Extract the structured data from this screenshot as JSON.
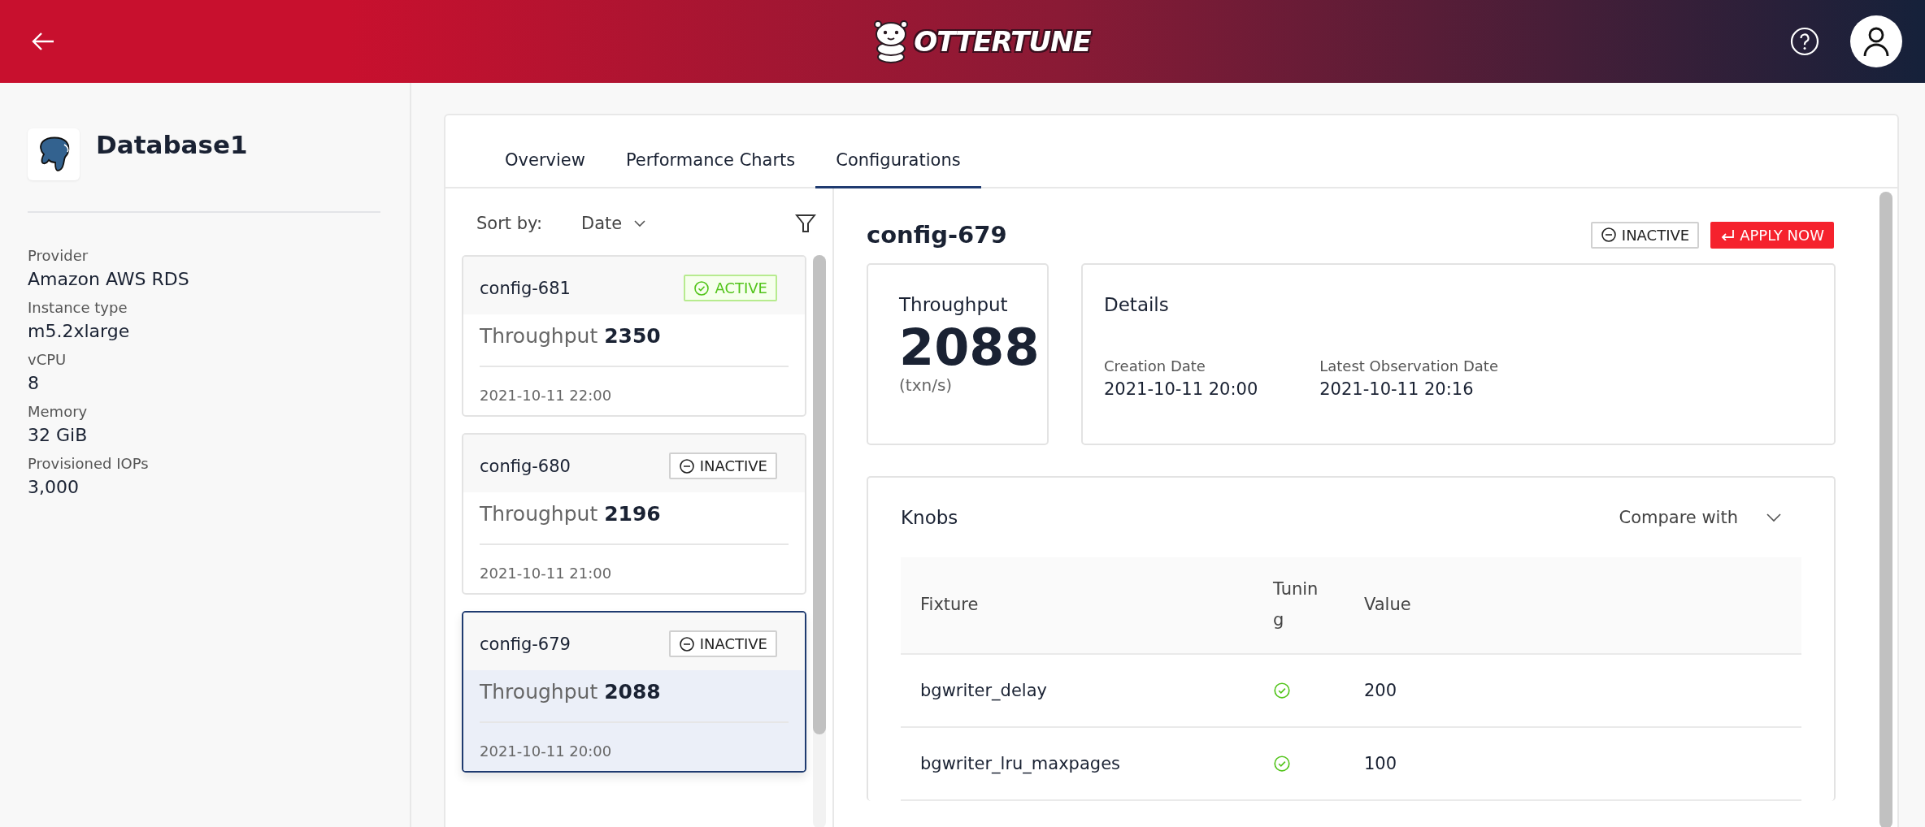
{
  "header": {
    "logo_text": "OTTERTUNE"
  },
  "database": {
    "name": "Database1",
    "properties": [
      {
        "label": "Provider",
        "value": "Amazon AWS RDS"
      },
      {
        "label": "Instance type",
        "value": "m5.2xlarge"
      },
      {
        "label": "vCPU",
        "value": "8"
      },
      {
        "label": "Memory",
        "value": "32 GiB"
      },
      {
        "label": "Provisioned IOPs",
        "value": "3,000"
      }
    ]
  },
  "tabs": [
    {
      "label": "Overview",
      "selected": false
    },
    {
      "label": "Performance Charts",
      "selected": false
    },
    {
      "label": "Configurations",
      "selected": true
    }
  ],
  "sort": {
    "label": "Sort by:",
    "value": "Date"
  },
  "configs": [
    {
      "name": "config-681",
      "kind": "active",
      "status_label": "ACTIVE",
      "metric_label": "Throughput",
      "metric_value": "2350",
      "date": "2021-10-11 22:00",
      "selected": false
    },
    {
      "name": "config-680",
      "kind": "inactive",
      "status_label": "INACTIVE",
      "metric_label": "Throughput",
      "metric_value": "2196",
      "date": "2021-10-11 21:00",
      "selected": false
    },
    {
      "name": "config-679",
      "kind": "inactive",
      "status_label": "INACTIVE",
      "metric_label": "Throughput",
      "metric_value": "2088",
      "date": "2021-10-11 20:00",
      "selected": true
    }
  ],
  "detail": {
    "title": "config-679",
    "kind": "inactive",
    "status_label": "INACTIVE",
    "apply_button": "APPLY NOW",
    "throughput": {
      "label": "Throughput",
      "value": "2088",
      "unit": "(txn/s)"
    },
    "details": {
      "title": "Details",
      "fields": [
        {
          "label": "Creation Date",
          "value": "2021-10-11 20:00"
        },
        {
          "label": "Latest Observation Date",
          "value": "2021-10-11 20:16"
        }
      ]
    },
    "knobs": {
      "title": "Knobs",
      "compare_label": "Compare with",
      "columns": [
        "Fixture",
        "Tuning",
        "Value"
      ],
      "rows": [
        {
          "fixture": "bgwriter_delay",
          "tuning": true,
          "value": "200"
        },
        {
          "fixture": "bgwriter_lru_maxpages",
          "tuning": true,
          "value": "100"
        }
      ]
    }
  }
}
